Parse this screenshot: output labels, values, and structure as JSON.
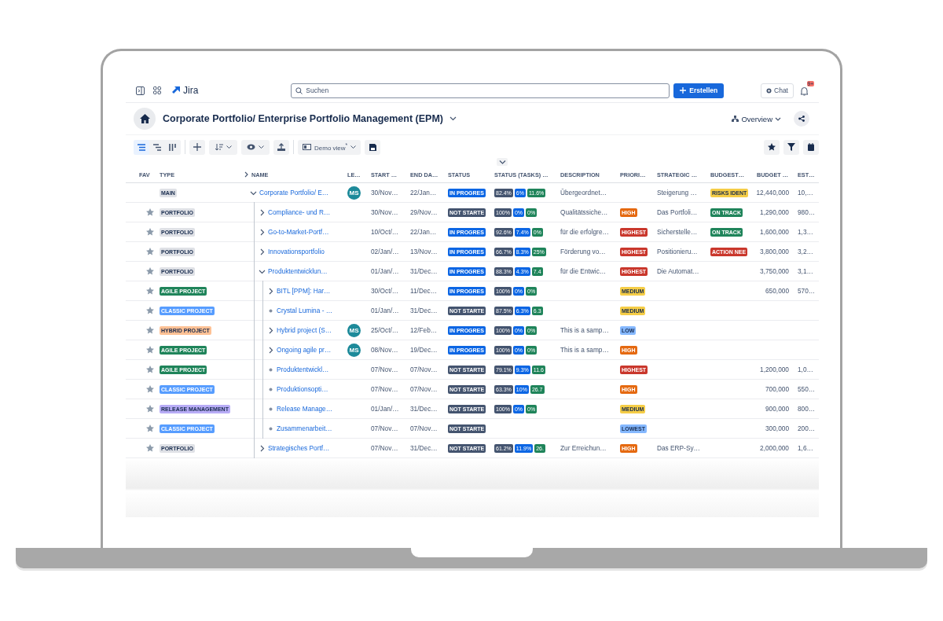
{
  "topbar": {
    "product": "Jira",
    "search": {
      "placeholder": "Suchen"
    },
    "create_button": "Erstellen",
    "chat_button": "Chat",
    "notification_badge": "9+"
  },
  "header": {
    "title": "Corporate Portfolio/ Enterprise Portfolio Management (EPM)",
    "view_switch": "Overview"
  },
  "toolbar": {
    "view_modes": [
      {
        "kind": "list",
        "selected": true
      },
      {
        "kind": "tree",
        "selected": false
      },
      {
        "kind": "board",
        "selected": false
      }
    ],
    "saved_view": "Demo view$^{*}$"
  },
  "table": {
    "columns": [
      "FAV",
      "TYPE",
      "NAME",
      "LE…",
      "START …",
      "END DA…",
      "STATUS",
      "STATUS (TASKS) …",
      "DESCRIPTION",
      "PRIORI…",
      "STRATEGIC …",
      "BUDGEST…",
      "BUDGET …",
      "EST…"
    ],
    "rows": [
      {
        "type": {
          "label": "MAIN",
          "color": "#dfe1e6"
        },
        "expanded": true,
        "name": "Corporate Portfolio/ E…",
        "lead": "MS",
        "start": "30/Nov…",
        "end": "22/Jan…",
        "status": {
          "label": "IN PROGRES",
          "color": "#0c66e4"
        },
        "tasks": [
          "82.4%",
          "6%",
          "11.6%"
        ],
        "description": "Übergeordnet…",
        "strategic": "Steigerung …",
        "budget_status": {
          "label": "RISKS IDENT",
          "color": "#f5cd47"
        },
        "budget": "12,440,000",
        "estimate": "10,…",
        "children": [
          {
            "fav": false,
            "type": {
              "label": "PORTFOLIO",
              "color": "#dfe1e6"
            },
            "expanded": false,
            "name": "Compliance- und R…",
            "start": "30/Nov…",
            "end": "29/Nov…",
            "status": {
              "label": "NOT STARTE",
              "color": "#44546f"
            },
            "tasks": [
              "100%",
              "0%",
              "0%"
            ],
            "description": "Qualitätssiche…",
            "priority": {
              "label": "HIGH",
              "color": "#e56910"
            },
            "strategic": "Das Portfoli…",
            "budget_status": {
              "label": "ON TRACK",
              "color": "#1f845a"
            },
            "budget": "1,290,000",
            "estimate": "980…"
          },
          {
            "fav": false,
            "type": {
              "label": "PORTFOLIO",
              "color": "#dfe1e6"
            },
            "expanded": false,
            "name": "Go-to-Market-Portf…",
            "start": "10/Oct/…",
            "end": "22/Jan…",
            "status": {
              "label": "IN PROGRES",
              "color": "#0c66e4"
            },
            "tasks": [
              "92.6%",
              "7.4%",
              "0%"
            ],
            "description": "für die erfolgre…",
            "priority": {
              "label": "HIGHEST",
              "color": "#c9372c"
            },
            "strategic": "Sicherstelle…",
            "budget_status": {
              "label": "ON TRACK",
              "color": "#1f845a"
            },
            "budget": "1,600,000",
            "estimate": "1,3…"
          },
          {
            "fav": false,
            "type": {
              "label": "PORTFOLIO",
              "color": "#dfe1e6"
            },
            "expanded": false,
            "name": "Innovationsportfolio",
            "start": "02/Jan/…",
            "end": "13/Nov…",
            "status": {
              "label": "IN PROGRES",
              "color": "#0c66e4"
            },
            "tasks": [
              "66.7%",
              "8.3%",
              "25%"
            ],
            "description": "Förderung vo…",
            "priority": {
              "label": "HIGHEST",
              "color": "#c9372c"
            },
            "strategic": "Positionieru…",
            "budget_status": {
              "label": "ACTION NEE",
              "color": "#c9372c"
            },
            "budget": "3,800,000",
            "estimate": "3,2…"
          },
          {
            "fav": false,
            "type": {
              "label": "PORTFOLIO",
              "color": "#dfe1e6"
            },
            "expanded": true,
            "name": "Produktentwicklun…",
            "start": "01/Jan/…",
            "end": "31/Dec…",
            "status": {
              "label": "IN PROGRES",
              "color": "#0c66e4"
            },
            "tasks": [
              "88.3%",
              "4.3%",
              "7.4"
            ],
            "description": "für die Entwic…",
            "priority": {
              "label": "HIGHEST",
              "color": "#c9372c"
            },
            "strategic": "Die Automat…",
            "budget": "3,750,000",
            "estimate": "3,1…",
            "children": [
              {
                "fav": false,
                "type": {
                  "label": "AGILE PROJECT",
                  "color": "#1f845a"
                },
                "expanded": false,
                "name": "BITL [PPM]: Har…",
                "start": "30/Oct/…",
                "end": "11/Dec…",
                "status": {
                  "label": "IN PROGRES",
                  "color": "#0c66e4"
                },
                "tasks": [
                  "100%",
                  "0%",
                  "0%"
                ],
                "priority": {
                  "label": "MEDIUM",
                  "color": "#f5cd47"
                },
                "budget": "650,000",
                "estimate": "570…"
              },
              {
                "fav": false,
                "type": {
                  "label": "CLASSIC PROJECT",
                  "color": "#579dff"
                },
                "name": "Crystal Lumina - …",
                "start": "01/Jan/…",
                "end": "31/Dec…",
                "status": {
                  "label": "NOT STARTE",
                  "color": "#44546f"
                },
                "tasks": [
                  "87.5%",
                  "6.3%",
                  "6.3"
                ],
                "priority": {
                  "label": "MEDIUM",
                  "color": "#f5cd47"
                }
              },
              {
                "fav": false,
                "type": {
                  "label": "HYBRID PROJECT",
                  "color": "#fec195"
                },
                "expanded": false,
                "name": "Hybrid project (S…",
                "lead": "MS",
                "start": "25/Oct/…",
                "end": "12/Feb…",
                "status": {
                  "label": "IN PROGRES",
                  "color": "#0c66e4"
                },
                "tasks": [
                  "100%",
                  "0%",
                  "0%"
                ],
                "description": "This is a samp…",
                "priority": {
                  "label": "LOW",
                  "color": "#85b8ff"
                }
              },
              {
                "fav": false,
                "type": {
                  "label": "AGILE PROJECT",
                  "color": "#1f845a"
                },
                "expanded": false,
                "name": "Ongoing agile pr…",
                "lead": "MS",
                "start": "08/Nov…",
                "end": "19/Dec…",
                "status": {
                  "label": "IN PROGRES",
                  "color": "#0c66e4"
                },
                "tasks": [
                  "100%",
                  "0%",
                  "0%"
                ],
                "description": "This is a samp…",
                "priority": {
                  "label": "HIGH",
                  "color": "#e56910"
                }
              },
              {
                "fav": false,
                "type": {
                  "label": "AGILE PROJECT",
                  "color": "#1f845a"
                },
                "name": "Produktentwickl…",
                "start": "07/Nov…",
                "end": "07/Nov…",
                "status": {
                  "label": "NOT STARTE",
                  "color": "#44546f"
                },
                "tasks": [
                  "79.1%",
                  "9.3%",
                  "11.6"
                ],
                "priority": {
                  "label": "HIGHEST",
                  "color": "#c9372c"
                },
                "budget": "1,200,000",
                "estimate": "1,0…"
              },
              {
                "fav": false,
                "type": {
                  "label": "CLASSIC PROJECT",
                  "color": "#579dff"
                },
                "name": "Produktionsopti…",
                "start": "07/Nov…",
                "end": "07/Nov…",
                "status": {
                  "label": "NOT STARTE",
                  "color": "#44546f"
                },
                "tasks": [
                  "63.3%",
                  "10%",
                  "26.7"
                ],
                "priority": {
                  "label": "HIGH",
                  "color": "#e56910"
                },
                "budget": "700,000",
                "estimate": "550…"
              },
              {
                "fav": false,
                "type": {
                  "label": "RELEASE MANAGEMENT",
                  "color": "#b8acf6"
                },
                "name": "Release Manage…",
                "start": "01/Jan/…",
                "end": "31/Dec…",
                "status": {
                  "label": "NOT STARTE",
                  "color": "#44546f"
                },
                "tasks": [
                  "100%",
                  "0%",
                  "0%"
                ],
                "priority": {
                  "label": "MEDIUM",
                  "color": "#f5cd47"
                },
                "budget": "900,000",
                "estimate": "800…"
              },
              {
                "fav": false,
                "type": {
                  "label": "CLASSIC PROJECT",
                  "color": "#579dff"
                },
                "name": "Zusammenarbeit…",
                "start": "07/Nov…",
                "end": "07/Nov…",
                "status": {
                  "label": "NOT STARTE",
                  "color": "#44546f"
                },
                "priority": {
                  "label": "LOWEST",
                  "color": "#85b8ff"
                },
                "budget": "300,000",
                "estimate": "200…"
              }
            ]
          },
          {
            "fav": false,
            "type": {
              "label": "PORTFOLIO",
              "color": "#dfe1e6"
            },
            "expanded": false,
            "name": "Strategisches Portf…",
            "start": "07/Nov…",
            "end": "31/Dec…",
            "status": {
              "label": "NOT STARTE",
              "color": "#44546f"
            },
            "tasks": [
              "61.2%",
              "11.9%",
              "26."
            ],
            "description": "Zur Erreichun…",
            "priority": {
              "label": "HIGH",
              "color": "#e56910"
            },
            "strategic": "Das ERP-Sy…",
            "budget": "2,000,000",
            "estimate": "1,6…"
          }
        ]
      }
    ]
  }
}
